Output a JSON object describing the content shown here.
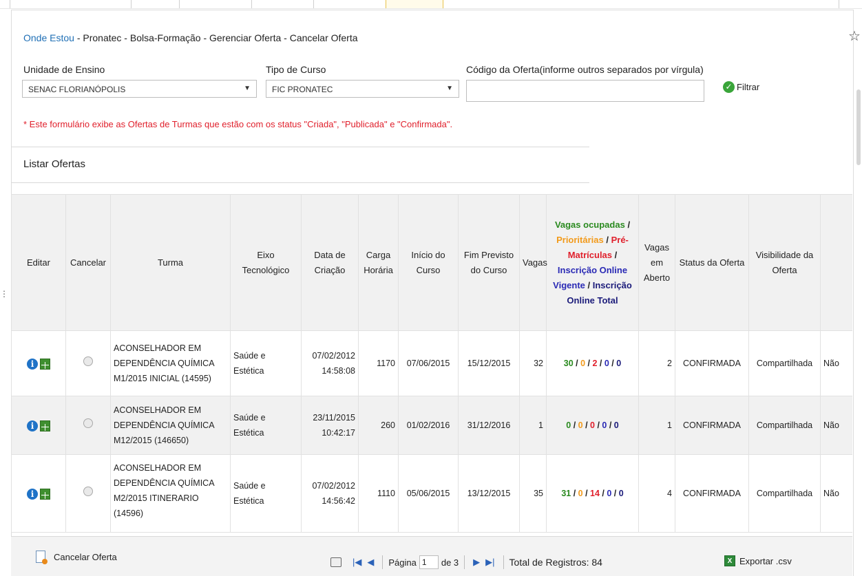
{
  "breadcrumb": {
    "link": "Onde Estou",
    "path": " - Pronatec - Bolsa-Formação - Gerenciar Oferta - Cancelar Oferta"
  },
  "filters": {
    "unidade_label": "Unidade de Ensino",
    "unidade_value": "SENAC FLORIANÓPOLIS",
    "tipo_label": "Tipo de Curso",
    "tipo_value": "FIC PRONATEC",
    "codigo_label": "Código da Oferta(informe outros separados por vírgula)",
    "codigo_value": "",
    "filtrar_label": "Filtrar"
  },
  "note": "* Este formulário exibe as Ofertas de Turmas que estão com os status \"Criada\", \"Publicada\" e \"Confirmada\".",
  "section_title": "Listar Ofertas",
  "table": {
    "headers": {
      "editar": "Editar",
      "cancelar": "Cancelar",
      "turma": "Turma",
      "eixo": "Eixo Tecnológico",
      "data": "Data de Criação",
      "carga": "Carga Horária",
      "inicio": "Início do Curso",
      "fim": "Fim Previsto do Curso",
      "vagas": "Vagas",
      "stats_ocupadas": "Vagas ocupadas",
      "stats_prioritarias": "Prioritárias",
      "stats_prematriculas": "Pré-Matrículas",
      "stats_vigente": "Inscrição Online Vigente",
      "stats_total": "Inscrição Online Total",
      "aberto": "Vagas em Aberto",
      "status": "Status da Oferta",
      "visibilidade": "Visibilidade da Oferta"
    },
    "rows": [
      {
        "turma": "ACONSELHADOR EM DEPENDÊNCIA QUÍMICA M1/2015 INICIAL (14595)",
        "eixo": "Saúde e Estética",
        "data": "07/02/2012 14:58:08",
        "carga": "1170",
        "inicio": "07/06/2015",
        "fim": "15/12/2015",
        "vagas": "32",
        "ocupadas": "30",
        "prioritarias": "0",
        "pre": "2",
        "vigente": "0",
        "total": "0",
        "aberto": "2",
        "status": "CONFIRMADA",
        "visibilidade": "Compartilhada",
        "extra": "Não"
      },
      {
        "turma": "ACONSELHADOR EM DEPENDÊNCIA QUÍMICA M12/2015 (146650)",
        "eixo": "Saúde e Estética",
        "data": "23/11/2015 10:42:17",
        "carga": "260",
        "inicio": "01/02/2016",
        "fim": "31/12/2016",
        "vagas": "1",
        "ocupadas": "0",
        "prioritarias": "0",
        "pre": "0",
        "vigente": "0",
        "total": "0",
        "aberto": "1",
        "status": "CONFIRMADA",
        "visibilidade": "Compartilhada",
        "extra": "Não"
      },
      {
        "turma": "ACONSELHADOR EM DEPENDÊNCIA QUÍMICA M2/2015 ITINERARIO (14596)",
        "eixo": "Saúde e Estética",
        "data": "07/02/2012 14:56:42",
        "carga": "1110",
        "inicio": "05/06/2015",
        "fim": "13/12/2015",
        "vagas": "35",
        "ocupadas": "31",
        "prioritarias": "0",
        "pre": "14",
        "vigente": "0",
        "total": "0",
        "aberto": "4",
        "status": "CONFIRMADA",
        "visibilidade": "Compartilhada",
        "extra": "Não"
      }
    ]
  },
  "footer": {
    "cancelar_oferta": "Cancelar Oferta",
    "pagina_label": "Página",
    "pagina_value": "1",
    "de_label": "de 3",
    "total_label": "Total de Registros: 84",
    "exportar_label": "Exportar .csv"
  },
  "colors": {
    "link": "#1f6fb5",
    "note": "#e0202c",
    "ocupadas": "#2a8a1f",
    "prioritarias": "#f29a1a",
    "prematriculas": "#e0202c",
    "vigente": "#2a2ab5",
    "total": "#1b1b7a"
  },
  "icons": [
    "star-icon",
    "ok-icon",
    "info-icon",
    "calendar-icon",
    "document-icon",
    "print-icon",
    "first-page-icon",
    "prev-page-icon",
    "next-page-icon",
    "last-page-icon",
    "excel-icon"
  ]
}
